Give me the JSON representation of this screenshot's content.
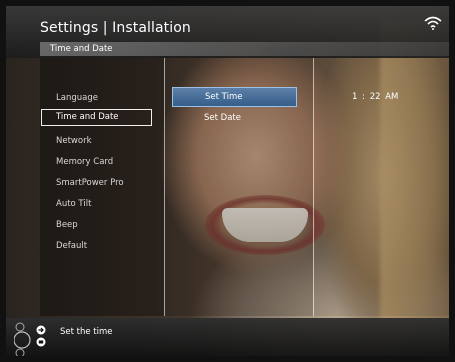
{
  "header": {
    "title": "Settings | Installation",
    "subtitle": "Time and Date"
  },
  "menu": {
    "items": [
      {
        "label": "Language"
      },
      {
        "label": "Time and Date",
        "selected": true
      },
      {
        "label": "Network"
      },
      {
        "label": "Memory Card"
      },
      {
        "label": "SmartPower Pro"
      },
      {
        "label": "Auto Tilt"
      },
      {
        "label": "Beep"
      },
      {
        "label": "Default"
      }
    ]
  },
  "submenu": {
    "options": [
      {
        "label": "Set Time",
        "highlighted": true
      },
      {
        "label": "Set Date"
      }
    ]
  },
  "current_time": {
    "hour": "1",
    "separator": ":",
    "minute": "22",
    "period": "AM"
  },
  "help": {
    "text": "Set the time"
  },
  "icons": {
    "status": "wifi-icon",
    "help": "navigation-ring-icon"
  },
  "colors": {
    "highlight": "#4a73a0",
    "highlight_border": "#9fc0e4",
    "selection_border": "#eeeeee"
  }
}
